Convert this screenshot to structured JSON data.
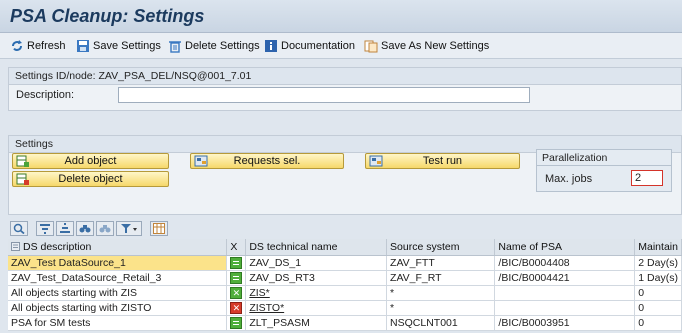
{
  "title": "PSA Cleanup: Settings",
  "toolbar": {
    "refresh": "Refresh",
    "save": "Save Settings",
    "delete": "Delete Settings",
    "documentation": "Documentation",
    "save_new": "Save As New Settings"
  },
  "settings_id": {
    "label": "Settings ID/node: ZAV_PSA_DEL/NSQ@001_7.01",
    "description_label": "Description:",
    "description_value": ""
  },
  "settings": {
    "header": "Settings",
    "add_object": "Add object",
    "delete_object": "Delete object",
    "requests_sel": "Requests sel.",
    "test_run": "Test run",
    "parallelization": "Parallelization",
    "max_jobs_label": "Max. jobs",
    "max_jobs_value": "2"
  },
  "grid": {
    "columns": [
      "DS description",
      "X",
      "DS technical name",
      "Source system",
      "Name of PSA",
      "Maintain"
    ],
    "rows": [
      {
        "desc": "ZAV_Test DataSource_1",
        "status": "green",
        "tech": "ZAV_DS_1",
        "source": "ZAV_FTT",
        "psa": "/BIC/B0004408",
        "maintain": "2 Day(s)"
      },
      {
        "desc": "ZAV_Test_DataSource_Retail_3",
        "status": "green",
        "tech": "ZAV_DS_RT3",
        "source": "ZAV_F_RT",
        "psa": "/BIC/B0004421",
        "maintain": "1 Day(s)"
      },
      {
        "desc": "All objects starting with ZIS",
        "status": "green-x",
        "tech": "ZIS*",
        "source": "*",
        "psa": "",
        "maintain": "0"
      },
      {
        "desc": "All objects starting with ZISTO",
        "status": "red-x",
        "tech": "ZISTO*",
        "source": "*",
        "psa": "",
        "maintain": "0"
      },
      {
        "desc": "PSA for SM tests",
        "status": "green",
        "tech": "ZLT_PSASM",
        "source": "NSQCLNT001",
        "psa": "/BIC/B0003951",
        "maintain": "0"
      }
    ]
  },
  "colors": {
    "title_text": "#1b3a5e",
    "button_fill": "#f6d86a",
    "selected_row": "#fbe38a",
    "status_green": "#4fae3a",
    "status_red": "#d63b2a"
  }
}
